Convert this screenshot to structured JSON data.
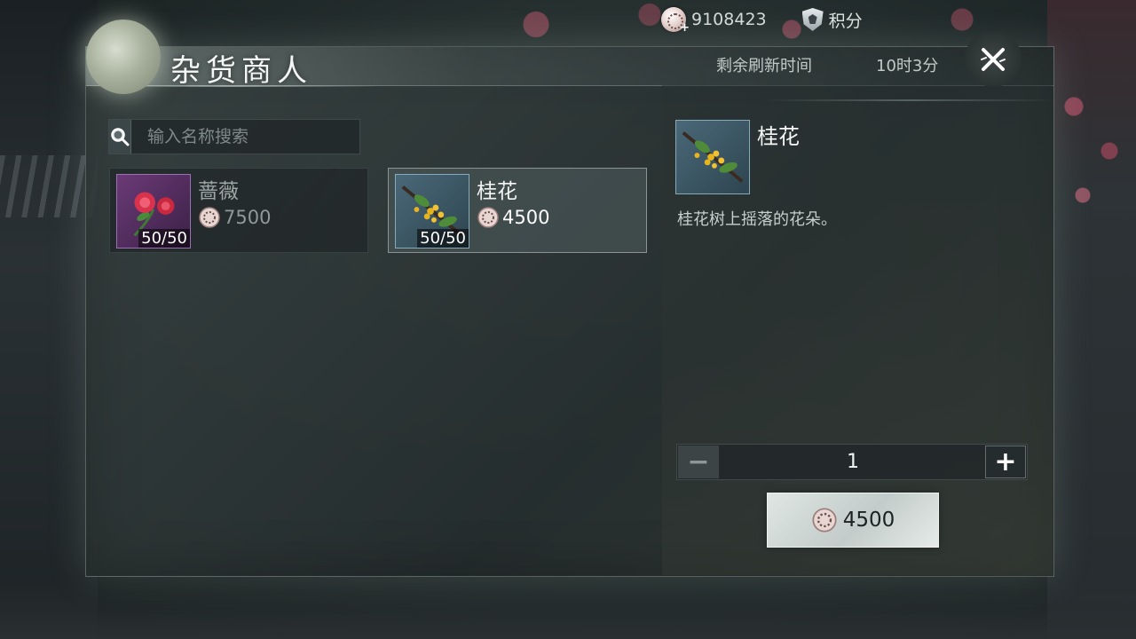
{
  "topbar": {
    "currency_value": "9108423",
    "points_label": "积分",
    "icons": [
      "coin-add-icon",
      "shield-points-icon"
    ]
  },
  "shop": {
    "title": "杂货商人",
    "refresh_label": "剩余刷新时间",
    "refresh_time": "10时3分"
  },
  "search": {
    "placeholder": "输入名称搜索",
    "value": ""
  },
  "items": [
    {
      "name": "蔷薇",
      "price": "7500",
      "stock": "50/50",
      "selected": false,
      "icon": "rose-icon"
    },
    {
      "name": "桂花",
      "price": "4500",
      "stock": "50/50",
      "selected": true,
      "icon": "osmanthus-icon"
    }
  ],
  "detail": {
    "name": "桂花",
    "description": "桂花树上摇落的花朵。",
    "quantity": "1",
    "buy_price": "4500"
  },
  "colors": {
    "accent": "#dfe6e4",
    "rose_frame": "#9a70b5",
    "osmanthus_frame": "#86a9bb"
  }
}
